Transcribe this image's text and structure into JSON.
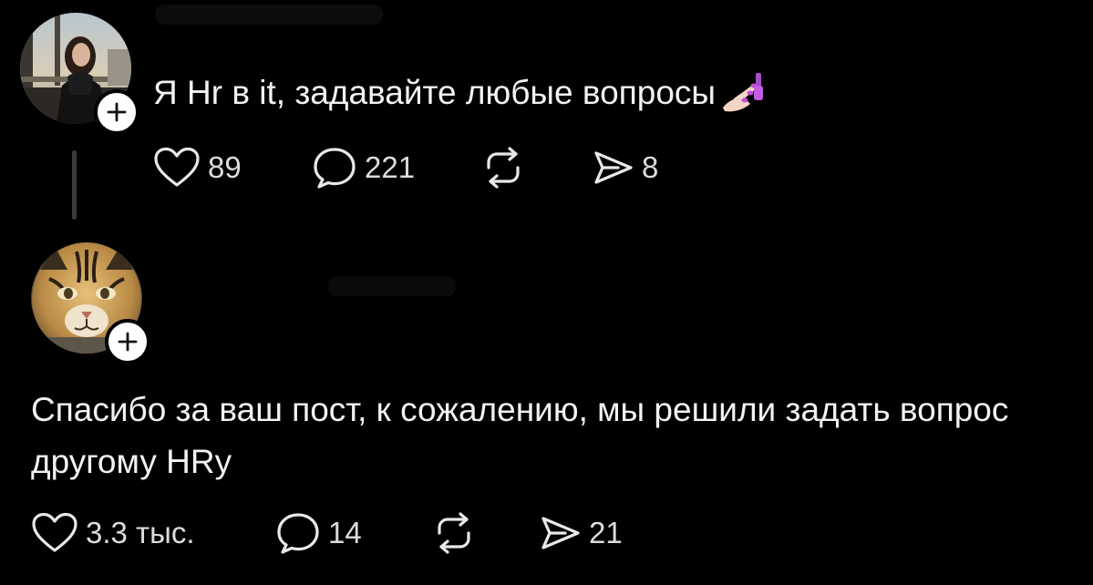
{
  "posts": [
    {
      "text": "Я Hr в it, задавайте любые вопросы",
      "emoji": "nail-polish-emoji",
      "avatar": "woman-by-window-avatar",
      "actions": {
        "likes": "89",
        "replies": "221",
        "reposts": "",
        "shares": "8"
      }
    },
    {
      "text": "Спасибо за ваш пост, к сожалению, мы решили задать вопрос другому HRу",
      "avatar": "ocelot-avatar",
      "actions": {
        "likes": "3.3 тыс.",
        "replies": "14",
        "reposts": "",
        "shares": "21"
      }
    }
  ],
  "icons": {
    "like": "heart-icon",
    "reply": "speech-bubble-icon",
    "repost": "repost-arrows-icon",
    "share": "paper-plane-icon",
    "follow": "plus-icon"
  },
  "colors": {
    "background": "#000000",
    "text": "#f2f2f2",
    "muted": "#dcdcdc",
    "thread_line": "#3b3b3b",
    "follow_button": "#ffffff"
  }
}
